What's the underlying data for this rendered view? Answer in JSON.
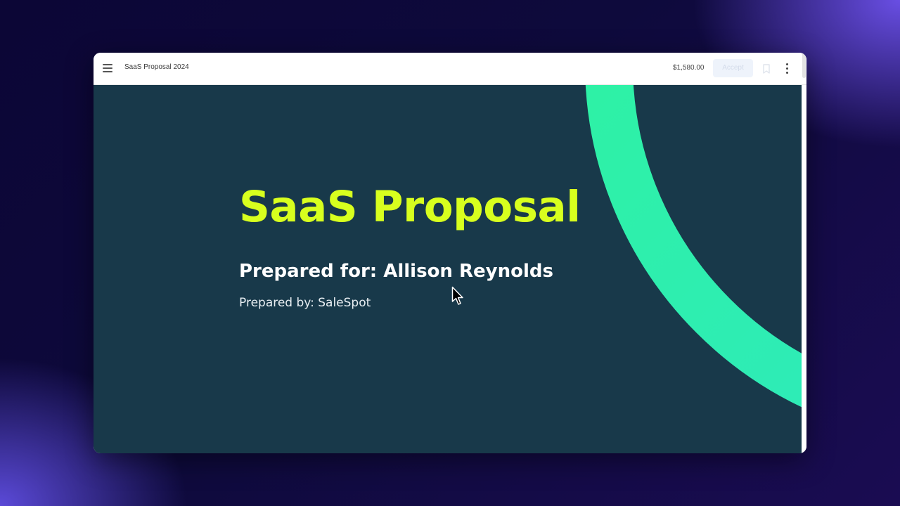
{
  "app": {
    "document_title": "SaaS Proposal 2024",
    "price": "$1,580.00",
    "accept_label": "Accept"
  },
  "icons": {
    "menu": "hamburger-menu-icon",
    "bookmark": "bookmark-icon",
    "more": "vertical-dots-icon",
    "cursor": "mouse-pointer-icon"
  },
  "slide": {
    "title": "SaaS Proposal",
    "prepared_for": "Prepared for: Allison Reynolds",
    "prepared_by": "Prepared by: SaleSpot"
  },
  "colors": {
    "slide_background": "#18394a",
    "title_color": "#d8ff1e",
    "arc_start": "#2ff59a",
    "arc_end": "#2de6c8",
    "accept_background": "#eef3fb"
  }
}
